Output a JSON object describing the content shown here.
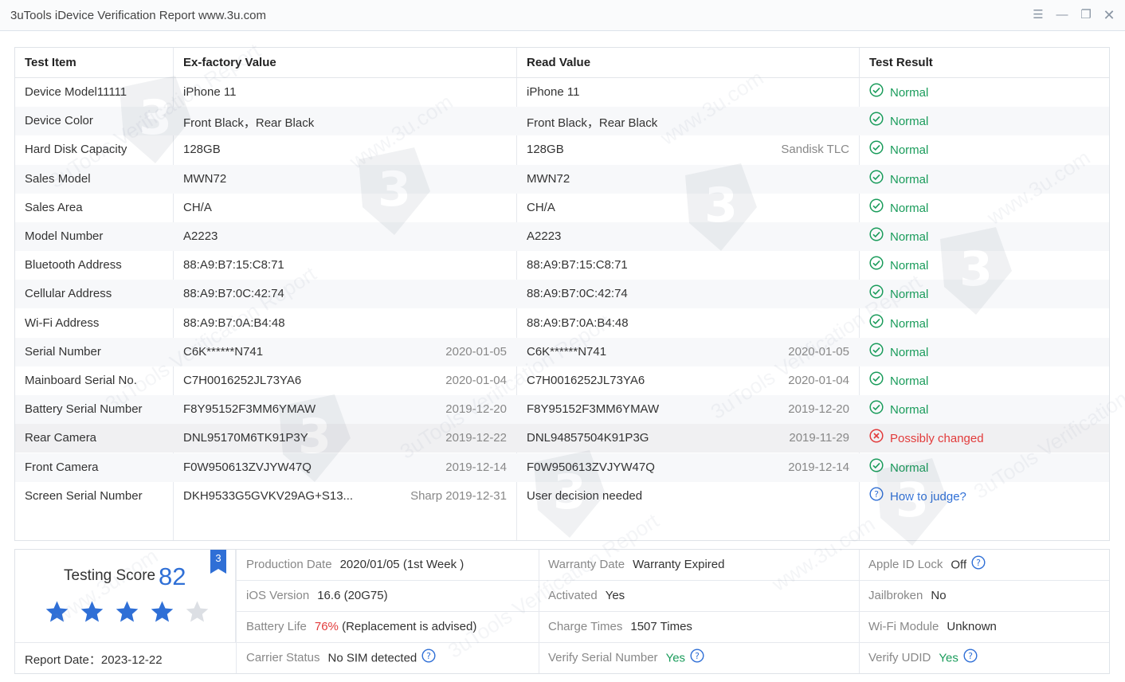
{
  "window": {
    "title": "3uTools iDevice Verification Report www.3u.com"
  },
  "table": {
    "headers": [
      "Test Item",
      "Ex-factory Value",
      "Read Value",
      "Test Result"
    ],
    "rows": [
      {
        "item": "Device Model11111",
        "ex": "iPhone 11",
        "ex_extra": "",
        "read": "iPhone 11",
        "read_extra": "",
        "result": "Normal",
        "status": "ok"
      },
      {
        "item": "Device Color",
        "ex": "Front Black，Rear Black",
        "ex_extra": "",
        "read": "Front Black，Rear Black",
        "read_extra": "",
        "result": "Normal",
        "status": "ok"
      },
      {
        "item": "Hard Disk Capacity",
        "ex": "128GB",
        "ex_extra": "",
        "read": "128GB",
        "read_extra": "Sandisk TLC",
        "result": "Normal",
        "status": "ok"
      },
      {
        "item": "Sales Model",
        "ex": "MWN72",
        "ex_extra": "",
        "read": "MWN72",
        "read_extra": "",
        "result": "Normal",
        "status": "ok"
      },
      {
        "item": "Sales Area",
        "ex": "CH/A",
        "ex_extra": "",
        "read": "CH/A",
        "read_extra": "",
        "result": "Normal",
        "status": "ok"
      },
      {
        "item": "Model Number",
        "ex": "A2223",
        "ex_extra": "",
        "read": "A2223",
        "read_extra": "",
        "result": "Normal",
        "status": "ok"
      },
      {
        "item": "Bluetooth Address",
        "ex": "88:A9:B7:15:C8:71",
        "ex_extra": "",
        "read": "88:A9:B7:15:C8:71",
        "read_extra": "",
        "result": "Normal",
        "status": "ok"
      },
      {
        "item": "Cellular Address",
        "ex": "88:A9:B7:0C:42:74",
        "ex_extra": "",
        "read": "88:A9:B7:0C:42:74",
        "read_extra": "",
        "result": "Normal",
        "status": "ok"
      },
      {
        "item": "Wi-Fi Address",
        "ex": "88:A9:B7:0A:B4:48",
        "ex_extra": "",
        "read": "88:A9:B7:0A:B4:48",
        "read_extra": "",
        "result": "Normal",
        "status": "ok"
      },
      {
        "item": "Serial Number",
        "ex": "C6K******N741",
        "ex_extra": "2020-01-05",
        "read": "C6K******N741",
        "read_extra": "2020-01-05",
        "result": "Normal",
        "status": "ok"
      },
      {
        "item": "Mainboard Serial No.",
        "ex": "C7H0016252JL73YA6",
        "ex_extra": "2020-01-04",
        "read": "C7H0016252JL73YA6",
        "read_extra": "2020-01-04",
        "result": "Normal",
        "status": "ok"
      },
      {
        "item": "Battery Serial Number",
        "ex": "F8Y95152F3MM6YMAW",
        "ex_extra": "2019-12-20",
        "read": "F8Y95152F3MM6YMAW",
        "read_extra": "2019-12-20",
        "result": "Normal",
        "status": "ok"
      },
      {
        "item": "Rear Camera",
        "ex": "DNL95170M6TK91P3Y",
        "ex_extra": "2019-12-22",
        "read": "DNL94857504K91P3G",
        "read_extra": "2019-11-29",
        "result": "Possibly changed",
        "status": "bad"
      },
      {
        "item": "Front Camera",
        "ex": "F0W950613ZVJYW47Q",
        "ex_extra": "2019-12-14",
        "read": "F0W950613ZVJYW47Q",
        "read_extra": "2019-12-14",
        "result": "Normal",
        "status": "ok"
      },
      {
        "item": "Screen Serial Number",
        "ex": "DKH9533G5GVKV29AG+S13...",
        "ex_extra": "Sharp 2019-12-31",
        "read": "User decision needed",
        "read_extra": "",
        "result": "How to judge?",
        "status": "help"
      }
    ]
  },
  "summary": {
    "score_label": "Testing Score",
    "score": "82",
    "badge": "3",
    "stars": {
      "filled": 4,
      "total": 5
    },
    "report_date_label": "Report Date：",
    "report_date": "2023-12-22",
    "production_date": {
      "label": "Production Date",
      "value": "2020/01/05 (1st Week )"
    },
    "ios_version": {
      "label": "iOS Version",
      "value": "16.6 (20G75)"
    },
    "battery_life": {
      "label": "Battery Life",
      "value": "76%",
      "note": "(Replacement is advised)"
    },
    "carrier_status": {
      "label": "Carrier Status",
      "value": "No SIM detected"
    },
    "warranty_date": {
      "label": "Warranty Date",
      "value": "Warranty Expired"
    },
    "activated": {
      "label": "Activated",
      "value": "Yes"
    },
    "charge_times": {
      "label": "Charge Times",
      "value": "1507 Times"
    },
    "verify_serial": {
      "label": "Verify Serial Number",
      "value": "Yes"
    },
    "apple_id_lock": {
      "label": "Apple ID Lock",
      "value": "Off"
    },
    "jailbroken": {
      "label": "Jailbroken",
      "value": "No"
    },
    "wifi_module": {
      "label": "Wi-Fi Module",
      "value": "Unknown"
    },
    "verify_udid": {
      "label": "Verify UDID",
      "value": "Yes"
    }
  },
  "watermarks": {
    "texts": [
      "3uTools Verification Report",
      "www.3u.com"
    ]
  },
  "colors": {
    "ok": "#1a9c5b",
    "bad": "#e23b3b",
    "accent": "#2f6fd6"
  }
}
